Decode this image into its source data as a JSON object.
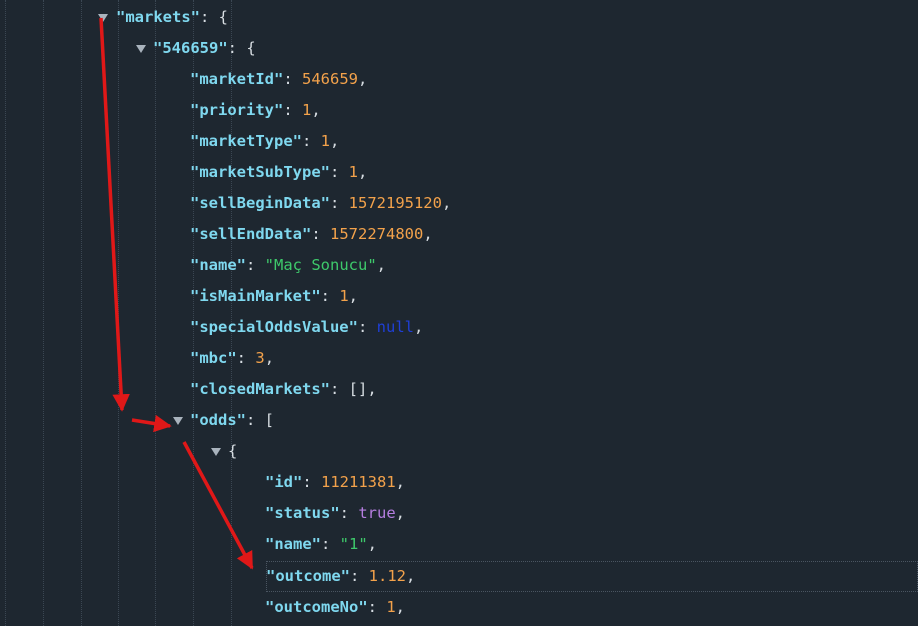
{
  "rows": [
    {
      "type": "open",
      "key": "markets",
      "bracket": "{"
    },
    {
      "type": "open",
      "key": "546659",
      "bracket": "{"
    },
    {
      "type": "kv",
      "key": "marketId",
      "value": "546659",
      "vtype": "num"
    },
    {
      "type": "kv",
      "key": "priority",
      "value": "1",
      "vtype": "num"
    },
    {
      "type": "kv",
      "key": "marketType",
      "value": "1",
      "vtype": "num"
    },
    {
      "type": "kv",
      "key": "marketSubType",
      "value": "1",
      "vtype": "num"
    },
    {
      "type": "kv",
      "key": "sellBeginData",
      "value": "1572195120",
      "vtype": "num"
    },
    {
      "type": "kv",
      "key": "sellEndData",
      "value": "1572274800",
      "vtype": "num"
    },
    {
      "type": "kv",
      "key": "name",
      "value": "\"Maç Sonucu\"",
      "vtype": "str"
    },
    {
      "type": "kv",
      "key": "isMainMarket",
      "value": "1",
      "vtype": "num"
    },
    {
      "type": "kv",
      "key": "specialOddsValue",
      "value": "null",
      "vtype": "nul"
    },
    {
      "type": "kv",
      "key": "mbc",
      "value": "3",
      "vtype": "num"
    },
    {
      "type": "kv",
      "key": "closedMarkets",
      "value": "[]",
      "vtype": "punct"
    },
    {
      "type": "open",
      "key": "odds",
      "bracket": "["
    },
    {
      "type": "open",
      "key": "",
      "bracket": "{"
    },
    {
      "type": "kv",
      "key": "id",
      "value": "11211381",
      "vtype": "num"
    },
    {
      "type": "kv",
      "key": "status",
      "value": "true",
      "vtype": "bool"
    },
    {
      "type": "kv",
      "key": "name",
      "value": "\"1\"",
      "vtype": "str"
    },
    {
      "type": "kv",
      "key": "outcome",
      "value": "1.12",
      "vtype": "num",
      "highlight": true
    },
    {
      "type": "kv",
      "key": "outcomeNo",
      "value": "1",
      "vtype": "num"
    }
  ],
  "colors": {
    "background": "#1e2730",
    "key": "#7fd8ef",
    "number": "#f3a24b",
    "string": "#3ec96b",
    "boolean": "#b57ee0",
    "null": "#1f3fd6",
    "annotation_arrow": "#e01818"
  },
  "icons": {
    "toggle": "caret-down-icon",
    "annotation": "red-arrow-icon"
  }
}
